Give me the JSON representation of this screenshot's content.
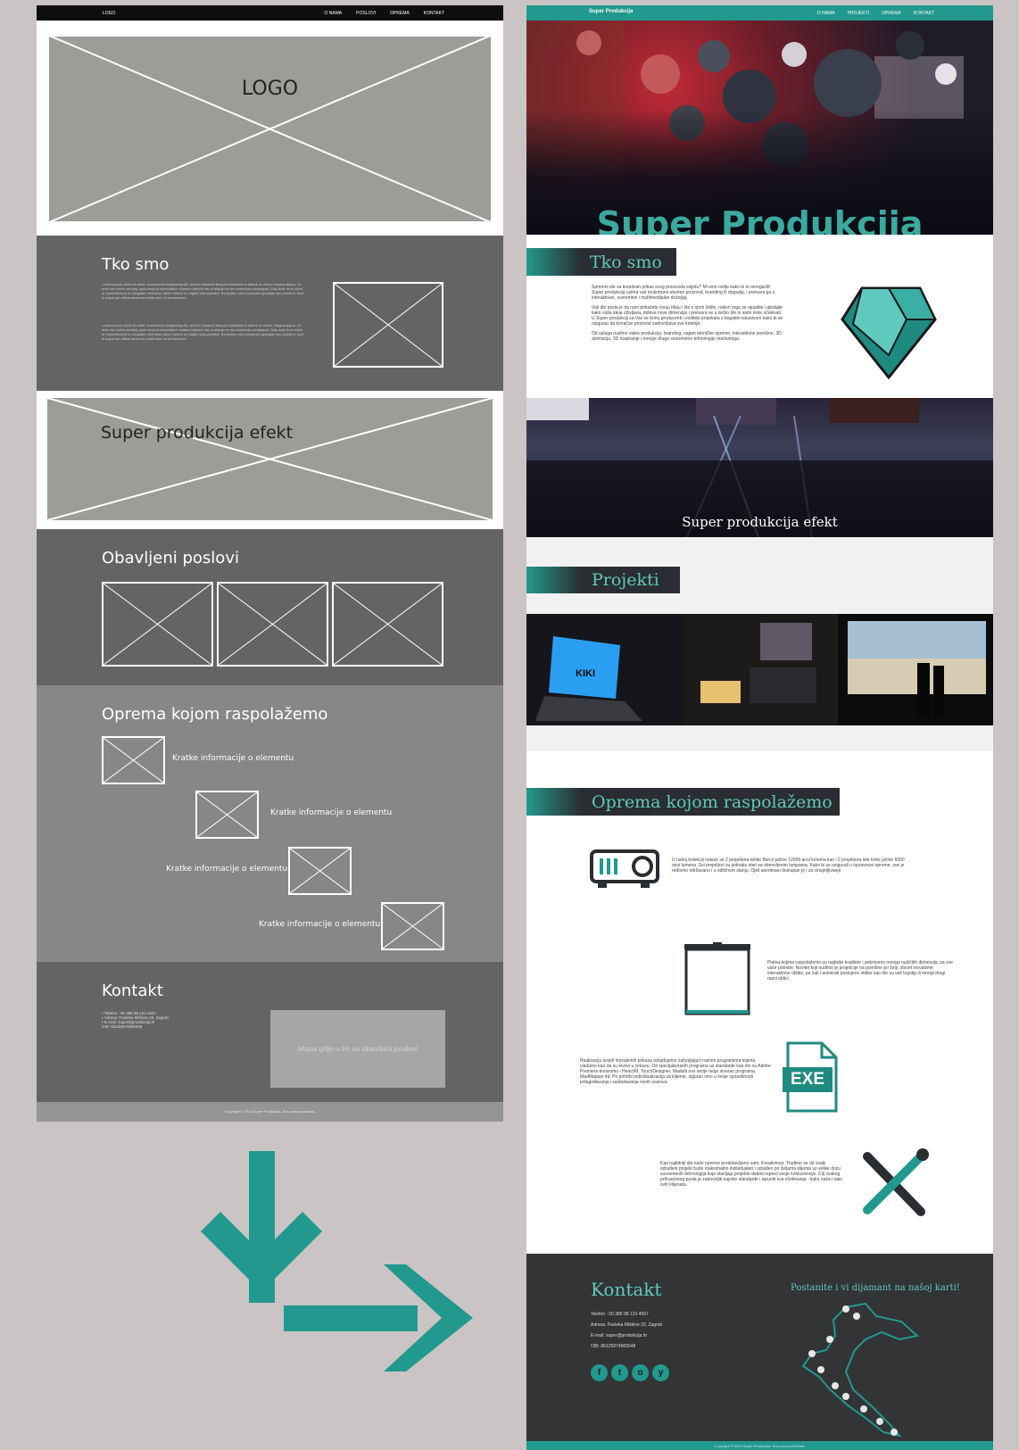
{
  "wireframe": {
    "nav": {
      "logo": "LOGO",
      "links": [
        "O NAMA",
        "POSLOVI",
        "OPREMA",
        "KONTAKT"
      ]
    },
    "hero_label": "LOGO",
    "about_title": "Tko smo",
    "about_lorem_1": "Lorem ipsum dolor sit amet, consectetur adipiscing elit, sed do eiusmod tempor incididunt ut labore et dolore magna aliqua. Ut enim ad minim veniam, quis nostrud exercitation ullamco laboris nisi ut aliquip ex ea commodo consequat. Duis aute irure dolor in reprehenderit in voluptate velit esse cillum dolore eu fugiat nulla pariatur. Excepteur sint occaecat cupidatat non proident, sunt in culpa qui officia deserunt mollit anim id est laborum.",
    "about_lorem_2": "Lorem ipsum dolor sit amet, consectetur adipiscing elit, sed do eiusmod tempor incididunt ut labore et dolore magna aliqua. Ut enim ad minim veniam, quis nostrud exercitation ullamco laboris nisi ut aliquip ex ea commodo consequat. Duis aute irure dolor in reprehenderit in voluptate velit esse cillum dolore eu fugiat nulla pariatur. Excepteur sint occaecat cupidatat non proident, sunt in culpa qui officia deserunt mollit anim id est laborum.",
    "effect_label": "Super produkcija efekt",
    "jobs_title": "Obavljeni poslovi",
    "equipment_title": "Oprema kojom raspolažemo",
    "equipment_info": [
      "Kratke informacije o elementu",
      "Kratke informacije o elementu",
      "Kratke informacije o elementu",
      "Kratke informacije o elementu"
    ],
    "contact_title": "Kontakt",
    "contact_lines": [
      "• Telefon : 00 385 98 123 4567",
      "• Adresa: Pavleka Miškine 33, Zagreb",
      "• E-mail: super@produkcija.hr",
      "OIB: 86125874965548"
    ],
    "map_placeholder": "Mapa gdje u Hr su obavljani poslovi",
    "footer": "Copyright © 2016 Super Produkcija. Sva prava pridržana."
  },
  "design": {
    "nav": {
      "brand": "Super Produkcija",
      "links": [
        "O NAMA",
        "PROJEKTI",
        "OPREMA",
        "KONTAKT"
      ]
    },
    "hero_title": "Super Produkcija",
    "about_title": "Tko smo",
    "about_p1": "Spremni ste za kreativan prikaz svog proizvoda svijetu? Mi smo ovdje kako bi to omogućili! Super produkcija uzima vaš mukotrpno stvoren proizvod, branding ili događaj, i pretvara ga u interaktivan, suvremeni i multimedijalan doživljaj.",
    "about_p2": "Vaš dio posla je da nam prikažete svoju ideju i što s njom želite, nakon toga se opustite i gledajte kako vaša ideja oživljava, dobiva nove dimenzije i pretvara se u nešto što ni sami niste očekivali. U Super produkciji za Vas se brinu producenti i voditelji projekata s bogatim iskustvom kako bi se osigurao da konačan proizvod zadovoljava sve kriterije.",
    "about_p3": "Od usluga nudimo video produkciju, branding, najam tehničke opreme, interaktivne površine, 3D animaciju, 3D mapiranje i mnoge druge suvremene tehnologije marketinga.",
    "effect_label": "Super produkcija efekt",
    "projects_title": "Projekti",
    "equipment_title": "Oprema kojom raspolažemo",
    "equip_1": "U našoj kolekciji nalaze se 2 projektora tehke Barco jačine 12000 ansi lumena kao i 2 projektora iste tvrke jačine 6000 ansi lumena. Svi projektori su jednako stari sa obnovljenim lampama. Kako bi se osigurali u ispravnost opreme, sve je redovno održavano i u odličnom stanju. Ojeli asortiman dostupan je i za cinajmljivanje.",
    "equip_2": "Platna kojima raspolažemo su najbolje kvalitete i pokrivamo mnogo različitih dimenzija, za sve vaše potrebe. Novitet koji nudimo je projekcije na površine po želji, stvorit inovativne interaktivno oblike, pa čak i animirati postojeće oblike kao što su vaš logotip ili mnogi drugi razni oblici.",
    "equip_3": "Realizaciju svojih inovativnih prikaza odrađujemo zahvaljujući raznim programima kojima vladamo kao da su levovi u cirkusu. Od specijaliziranih programa uz standarde kao što su Adobe Premiere korisnimo i HeavyM, TouchDesigner, Madulit ove serije nego stvaran programa, MadMapper itd. Po potrebi individualizacija za klijente, siguran smo u svoje sposobnosti prilagođavanja i savladavanja novih izazova.",
    "equip_4": "Kao najbitniji dio naše opreme predstavljamo vam: Kreativnost. Trudimo se da svaki odrađeni projekt bude maksimalno individualan i odrađen po željama klijenta uz velike dozu suvremenih tehnologija koje stavljaju projekte daleko ispred svoje konkurencije. Cilj svakog prihvaćenog posla je zadovoljiti najviše standarde i ispuniti sva očekivanja - kako naša i tako svih klijenata.",
    "exe_label": "EXE",
    "contact_title": "Kontakt",
    "contact_lines": [
      "Telefon : 00 385 98 123 4567",
      "Adresa: Pavleka Miškine 33, Zagreb",
      "E-mail: super@produkcija.hr",
      "OIB: 86125874965548"
    ],
    "map_caption": "Postanite i vi dijamant na našoj karti!",
    "social": [
      "f",
      "t",
      "o",
      "y"
    ],
    "footer": "Copyright © 2016 Super Produkcija. Sva prava pridržana."
  },
  "colors": {
    "teal": "#22998e",
    "teal_light": "#5fc9bd",
    "dark": "#2a2d31",
    "background": "#cbc4c4"
  },
  "arrows": [
    "arrow-down-icon",
    "arrow-right-icon"
  ]
}
